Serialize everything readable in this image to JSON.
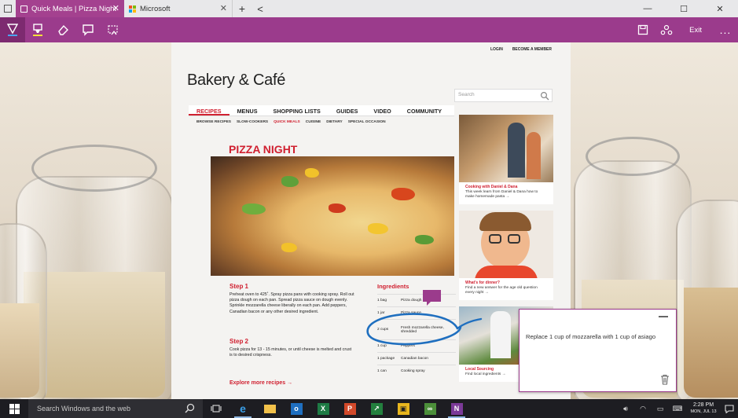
{
  "browser": {
    "tabs": [
      {
        "title": "Quick Meals | Pizza Night",
        "active": true
      },
      {
        "title": "Microsoft",
        "active": false
      }
    ],
    "new_tab": "+",
    "back": "<"
  },
  "ink_toolbar": {
    "tools": [
      "pen-icon",
      "highlighter-icon",
      "eraser-icon",
      "note-icon",
      "clip-icon"
    ],
    "right_tools": [
      "save-icon",
      "share-icon"
    ],
    "exit_label": "Exit",
    "more_label": "..."
  },
  "site": {
    "top_links": [
      "LOGIN",
      "BECOME A MEMBER"
    ],
    "brand": "Bakery & Café",
    "search_placeholder": "Search",
    "nav": [
      {
        "label": "RECIPES",
        "active": true
      },
      {
        "label": "MENUS",
        "active": false
      },
      {
        "label": "SHOPPING LISTS",
        "active": false
      },
      {
        "label": "GUIDES",
        "active": false
      },
      {
        "label": "VIDEO",
        "active": false
      },
      {
        "label": "COMMUNITY",
        "active": false
      }
    ],
    "subnav": [
      {
        "label": "BROWSE RECIPES",
        "active": false
      },
      {
        "label": "SLOW-COOKERS",
        "active": false
      },
      {
        "label": "QUICK MEALS",
        "active": true
      },
      {
        "label": "CUISINE",
        "active": false
      },
      {
        "label": "DIETARY",
        "active": false
      },
      {
        "label": "SPECIAL OCCASION",
        "active": false
      }
    ],
    "recipe_title": "PIZZA NIGHT",
    "step1_title": "Step 1",
    "step1_text": "Preheat oven to 425˚. Spray pizza pans with cooking spray. Roll out pizza dough on each pan. Spread pizza sauce on dough evenly. Sprinkle mozzarella cheese liberally on each pan. Add peppers, Canadian bacon or any other desired ingredient.",
    "step2_title": "Step 2",
    "step2_text": "Cook pizza for 13 - 15 minutes, or until cheese is melted and crust is to desired crispness.",
    "explore_link": "Explore more recipes →",
    "ingredients_title": "Ingredients",
    "ingredients": [
      {
        "qty": "1 bag",
        "item": "Pizza dough"
      },
      {
        "qty": "1 jar",
        "item": "Pizza sauce"
      },
      {
        "qty": "2 cups",
        "item": "Fresh mozzarella cheese, shredded"
      },
      {
        "qty": "1 cup",
        "item": "Peppers"
      },
      {
        "qty": "1 package",
        "item": "Canadian bacon"
      },
      {
        "qty": "1 can",
        "item": "Cooking spray"
      }
    ],
    "sidebar": [
      {
        "caption": "Cooking with Daniel & Dana",
        "text": "This week learn from Daniel & Dana how to make homemade pasta →"
      },
      {
        "caption": "What's for dinner?",
        "text": "Find a new answer for the age old question every night →"
      },
      {
        "caption": "Local Sourcing",
        "text": "Find local ingredients →"
      }
    ]
  },
  "ink": {
    "note_text": "Replace 1 cup of mozzarella with 1 cup of asiago",
    "colors": {
      "ink": "#1f6fbf",
      "accent": "#9b3b8c"
    }
  },
  "taskbar": {
    "search_placeholder": "Search Windows and the web",
    "apps": [
      "task-view-icon",
      "edge-icon",
      "file-explorer-icon",
      "outlook-icon",
      "excel-icon",
      "powerpoint-icon",
      "money-icon",
      "news-icon",
      "tripadvisor-icon",
      "onenote-icon"
    ],
    "time": "2:28 PM",
    "date": "MON, JUL 13"
  }
}
